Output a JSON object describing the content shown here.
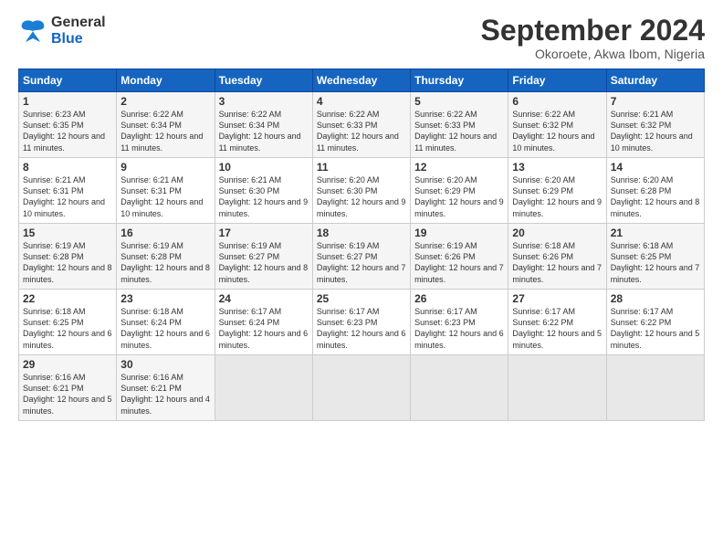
{
  "logo": {
    "line1": "General",
    "line2": "Blue"
  },
  "title": "September 2024",
  "subtitle": "Okoroete, Akwa Ibom, Nigeria",
  "headers": [
    "Sunday",
    "Monday",
    "Tuesday",
    "Wednesday",
    "Thursday",
    "Friday",
    "Saturday"
  ],
  "weeks": [
    [
      {
        "day": "1",
        "sunrise": "6:23 AM",
        "sunset": "6:35 PM",
        "daylight": "12 hours and 11 minutes."
      },
      {
        "day": "2",
        "sunrise": "6:22 AM",
        "sunset": "6:34 PM",
        "daylight": "12 hours and 11 minutes."
      },
      {
        "day": "3",
        "sunrise": "6:22 AM",
        "sunset": "6:34 PM",
        "daylight": "12 hours and 11 minutes."
      },
      {
        "day": "4",
        "sunrise": "6:22 AM",
        "sunset": "6:33 PM",
        "daylight": "12 hours and 11 minutes."
      },
      {
        "day": "5",
        "sunrise": "6:22 AM",
        "sunset": "6:33 PM",
        "daylight": "12 hours and 11 minutes."
      },
      {
        "day": "6",
        "sunrise": "6:22 AM",
        "sunset": "6:32 PM",
        "daylight": "12 hours and 10 minutes."
      },
      {
        "day": "7",
        "sunrise": "6:21 AM",
        "sunset": "6:32 PM",
        "daylight": "12 hours and 10 minutes."
      }
    ],
    [
      {
        "day": "8",
        "sunrise": "6:21 AM",
        "sunset": "6:31 PM",
        "daylight": "12 hours and 10 minutes."
      },
      {
        "day": "9",
        "sunrise": "6:21 AM",
        "sunset": "6:31 PM",
        "daylight": "12 hours and 10 minutes."
      },
      {
        "day": "10",
        "sunrise": "6:21 AM",
        "sunset": "6:30 PM",
        "daylight": "12 hours and 9 minutes."
      },
      {
        "day": "11",
        "sunrise": "6:20 AM",
        "sunset": "6:30 PM",
        "daylight": "12 hours and 9 minutes."
      },
      {
        "day": "12",
        "sunrise": "6:20 AM",
        "sunset": "6:29 PM",
        "daylight": "12 hours and 9 minutes."
      },
      {
        "day": "13",
        "sunrise": "6:20 AM",
        "sunset": "6:29 PM",
        "daylight": "12 hours and 9 minutes."
      },
      {
        "day": "14",
        "sunrise": "6:20 AM",
        "sunset": "6:28 PM",
        "daylight": "12 hours and 8 minutes."
      }
    ],
    [
      {
        "day": "15",
        "sunrise": "6:19 AM",
        "sunset": "6:28 PM",
        "daylight": "12 hours and 8 minutes."
      },
      {
        "day": "16",
        "sunrise": "6:19 AM",
        "sunset": "6:28 PM",
        "daylight": "12 hours and 8 minutes."
      },
      {
        "day": "17",
        "sunrise": "6:19 AM",
        "sunset": "6:27 PM",
        "daylight": "12 hours and 8 minutes."
      },
      {
        "day": "18",
        "sunrise": "6:19 AM",
        "sunset": "6:27 PM",
        "daylight": "12 hours and 7 minutes."
      },
      {
        "day": "19",
        "sunrise": "6:19 AM",
        "sunset": "6:26 PM",
        "daylight": "12 hours and 7 minutes."
      },
      {
        "day": "20",
        "sunrise": "6:18 AM",
        "sunset": "6:26 PM",
        "daylight": "12 hours and 7 minutes."
      },
      {
        "day": "21",
        "sunrise": "6:18 AM",
        "sunset": "6:25 PM",
        "daylight": "12 hours and 7 minutes."
      }
    ],
    [
      {
        "day": "22",
        "sunrise": "6:18 AM",
        "sunset": "6:25 PM",
        "daylight": "12 hours and 6 minutes."
      },
      {
        "day": "23",
        "sunrise": "6:18 AM",
        "sunset": "6:24 PM",
        "daylight": "12 hours and 6 minutes."
      },
      {
        "day": "24",
        "sunrise": "6:17 AM",
        "sunset": "6:24 PM",
        "daylight": "12 hours and 6 minutes."
      },
      {
        "day": "25",
        "sunrise": "6:17 AM",
        "sunset": "6:23 PM",
        "daylight": "12 hours and 6 minutes."
      },
      {
        "day": "26",
        "sunrise": "6:17 AM",
        "sunset": "6:23 PM",
        "daylight": "12 hours and 6 minutes."
      },
      {
        "day": "27",
        "sunrise": "6:17 AM",
        "sunset": "6:22 PM",
        "daylight": "12 hours and 5 minutes."
      },
      {
        "day": "28",
        "sunrise": "6:17 AM",
        "sunset": "6:22 PM",
        "daylight": "12 hours and 5 minutes."
      }
    ],
    [
      {
        "day": "29",
        "sunrise": "6:16 AM",
        "sunset": "6:21 PM",
        "daylight": "12 hours and 5 minutes."
      },
      {
        "day": "30",
        "sunrise": "6:16 AM",
        "sunset": "6:21 PM",
        "daylight": "12 hours and 4 minutes."
      },
      null,
      null,
      null,
      null,
      null
    ]
  ]
}
